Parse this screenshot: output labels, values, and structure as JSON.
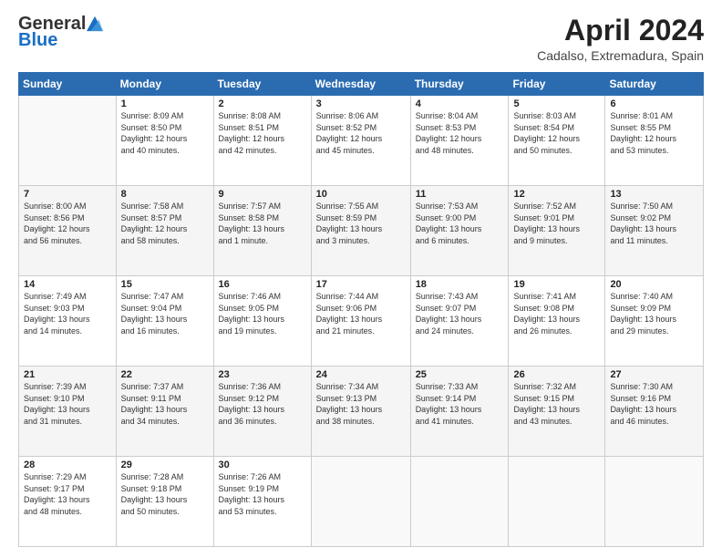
{
  "logo": {
    "general": "General",
    "blue": "Blue"
  },
  "header": {
    "title": "April 2024",
    "subtitle": "Cadalso, Extremadura, Spain"
  },
  "days_of_week": [
    "Sunday",
    "Monday",
    "Tuesday",
    "Wednesday",
    "Thursday",
    "Friday",
    "Saturday"
  ],
  "weeks": [
    [
      {
        "day": "",
        "info": ""
      },
      {
        "day": "1",
        "info": "Sunrise: 8:09 AM\nSunset: 8:50 PM\nDaylight: 12 hours\nand 40 minutes."
      },
      {
        "day": "2",
        "info": "Sunrise: 8:08 AM\nSunset: 8:51 PM\nDaylight: 12 hours\nand 42 minutes."
      },
      {
        "day": "3",
        "info": "Sunrise: 8:06 AM\nSunset: 8:52 PM\nDaylight: 12 hours\nand 45 minutes."
      },
      {
        "day": "4",
        "info": "Sunrise: 8:04 AM\nSunset: 8:53 PM\nDaylight: 12 hours\nand 48 minutes."
      },
      {
        "day": "5",
        "info": "Sunrise: 8:03 AM\nSunset: 8:54 PM\nDaylight: 12 hours\nand 50 minutes."
      },
      {
        "day": "6",
        "info": "Sunrise: 8:01 AM\nSunset: 8:55 PM\nDaylight: 12 hours\nand 53 minutes."
      }
    ],
    [
      {
        "day": "7",
        "info": "Sunrise: 8:00 AM\nSunset: 8:56 PM\nDaylight: 12 hours\nand 56 minutes."
      },
      {
        "day": "8",
        "info": "Sunrise: 7:58 AM\nSunset: 8:57 PM\nDaylight: 12 hours\nand 58 minutes."
      },
      {
        "day": "9",
        "info": "Sunrise: 7:57 AM\nSunset: 8:58 PM\nDaylight: 13 hours\nand 1 minute."
      },
      {
        "day": "10",
        "info": "Sunrise: 7:55 AM\nSunset: 8:59 PM\nDaylight: 13 hours\nand 3 minutes."
      },
      {
        "day": "11",
        "info": "Sunrise: 7:53 AM\nSunset: 9:00 PM\nDaylight: 13 hours\nand 6 minutes."
      },
      {
        "day": "12",
        "info": "Sunrise: 7:52 AM\nSunset: 9:01 PM\nDaylight: 13 hours\nand 9 minutes."
      },
      {
        "day": "13",
        "info": "Sunrise: 7:50 AM\nSunset: 9:02 PM\nDaylight: 13 hours\nand 11 minutes."
      }
    ],
    [
      {
        "day": "14",
        "info": "Sunrise: 7:49 AM\nSunset: 9:03 PM\nDaylight: 13 hours\nand 14 minutes."
      },
      {
        "day": "15",
        "info": "Sunrise: 7:47 AM\nSunset: 9:04 PM\nDaylight: 13 hours\nand 16 minutes."
      },
      {
        "day": "16",
        "info": "Sunrise: 7:46 AM\nSunset: 9:05 PM\nDaylight: 13 hours\nand 19 minutes."
      },
      {
        "day": "17",
        "info": "Sunrise: 7:44 AM\nSunset: 9:06 PM\nDaylight: 13 hours\nand 21 minutes."
      },
      {
        "day": "18",
        "info": "Sunrise: 7:43 AM\nSunset: 9:07 PM\nDaylight: 13 hours\nand 24 minutes."
      },
      {
        "day": "19",
        "info": "Sunrise: 7:41 AM\nSunset: 9:08 PM\nDaylight: 13 hours\nand 26 minutes."
      },
      {
        "day": "20",
        "info": "Sunrise: 7:40 AM\nSunset: 9:09 PM\nDaylight: 13 hours\nand 29 minutes."
      }
    ],
    [
      {
        "day": "21",
        "info": "Sunrise: 7:39 AM\nSunset: 9:10 PM\nDaylight: 13 hours\nand 31 minutes."
      },
      {
        "day": "22",
        "info": "Sunrise: 7:37 AM\nSunset: 9:11 PM\nDaylight: 13 hours\nand 34 minutes."
      },
      {
        "day": "23",
        "info": "Sunrise: 7:36 AM\nSunset: 9:12 PM\nDaylight: 13 hours\nand 36 minutes."
      },
      {
        "day": "24",
        "info": "Sunrise: 7:34 AM\nSunset: 9:13 PM\nDaylight: 13 hours\nand 38 minutes."
      },
      {
        "day": "25",
        "info": "Sunrise: 7:33 AM\nSunset: 9:14 PM\nDaylight: 13 hours\nand 41 minutes."
      },
      {
        "day": "26",
        "info": "Sunrise: 7:32 AM\nSunset: 9:15 PM\nDaylight: 13 hours\nand 43 minutes."
      },
      {
        "day": "27",
        "info": "Sunrise: 7:30 AM\nSunset: 9:16 PM\nDaylight: 13 hours\nand 46 minutes."
      }
    ],
    [
      {
        "day": "28",
        "info": "Sunrise: 7:29 AM\nSunset: 9:17 PM\nDaylight: 13 hours\nand 48 minutes."
      },
      {
        "day": "29",
        "info": "Sunrise: 7:28 AM\nSunset: 9:18 PM\nDaylight: 13 hours\nand 50 minutes."
      },
      {
        "day": "30",
        "info": "Sunrise: 7:26 AM\nSunset: 9:19 PM\nDaylight: 13 hours\nand 53 minutes."
      },
      {
        "day": "",
        "info": ""
      },
      {
        "day": "",
        "info": ""
      },
      {
        "day": "",
        "info": ""
      },
      {
        "day": "",
        "info": ""
      }
    ]
  ]
}
